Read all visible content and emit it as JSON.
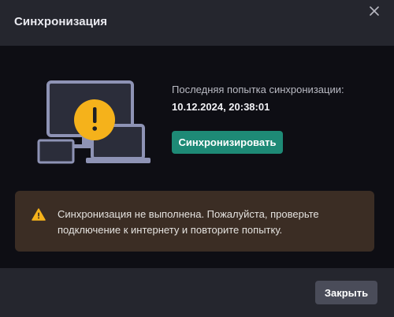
{
  "dialog": {
    "title": "Синхронизация",
    "close_icon": "close-icon"
  },
  "sync": {
    "last_attempt_label": "Последняя попытка синхронизации:",
    "last_attempt_value": "10.12.2024, 20:38:01",
    "button_label": "Синхронизировать"
  },
  "illustration": {
    "icon": "devices-warning-icon",
    "warning_glyph": "!"
  },
  "alert": {
    "icon": "warning-triangle-icon",
    "message": "Синхронизация не выполнена. Пожалуйста, проверьте подключение к интернету и повторите попытку."
  },
  "footer": {
    "close_label": "Закрыть"
  },
  "colors": {
    "accent": "#1e8a76",
    "warning": "#f5b21b",
    "alert_bg": "#3b2d24"
  }
}
